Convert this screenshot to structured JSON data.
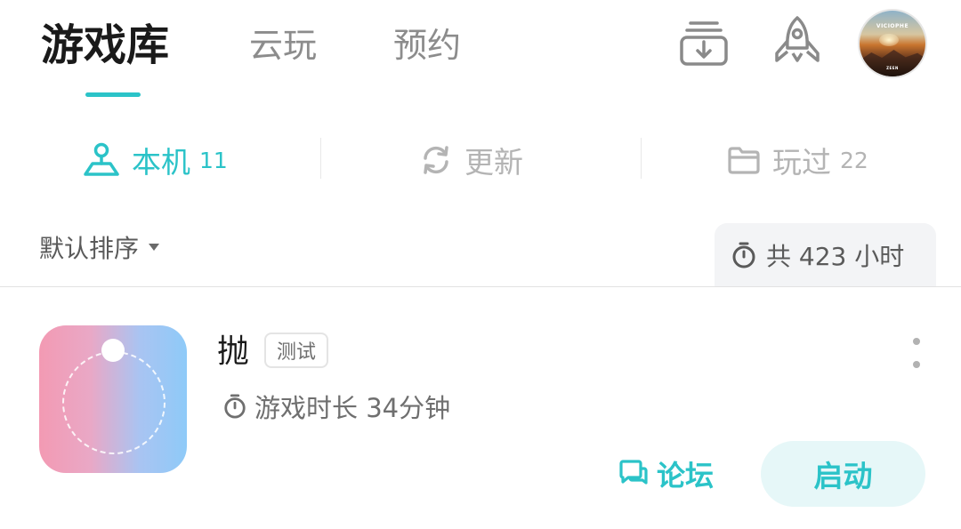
{
  "top_tabs": [
    {
      "label": "游戏库",
      "active": true
    },
    {
      "label": "云玩",
      "active": false
    },
    {
      "label": "预约",
      "active": false
    }
  ],
  "header_icons": {
    "download": "download-icon",
    "rocket": "rocket-icon",
    "avatar_text_1": "VICIOPHE",
    "avatar_text_2": "ZEEN"
  },
  "sub_tabs": [
    {
      "label": "本机",
      "count": "11",
      "icon": "gamepad-user-icon",
      "active": true
    },
    {
      "label": "更新",
      "count": "",
      "icon": "refresh-icon",
      "active": false
    },
    {
      "label": "玩过",
      "count": "22",
      "icon": "folder-icon",
      "active": false
    }
  ],
  "sort": {
    "label": "默认排序",
    "icon": "caret-down-icon"
  },
  "total": {
    "label": "共 423 小时",
    "icon": "stopwatch-icon"
  },
  "game": {
    "title": "抛",
    "tag": "测试",
    "playtime": "游戏时长 34分钟",
    "forum_label": "论坛",
    "launch_label": "启动"
  },
  "colors": {
    "accent": "#2bc3c8",
    "muted": "#b4b4b4",
    "launch_bg": "#e6f7f8"
  }
}
